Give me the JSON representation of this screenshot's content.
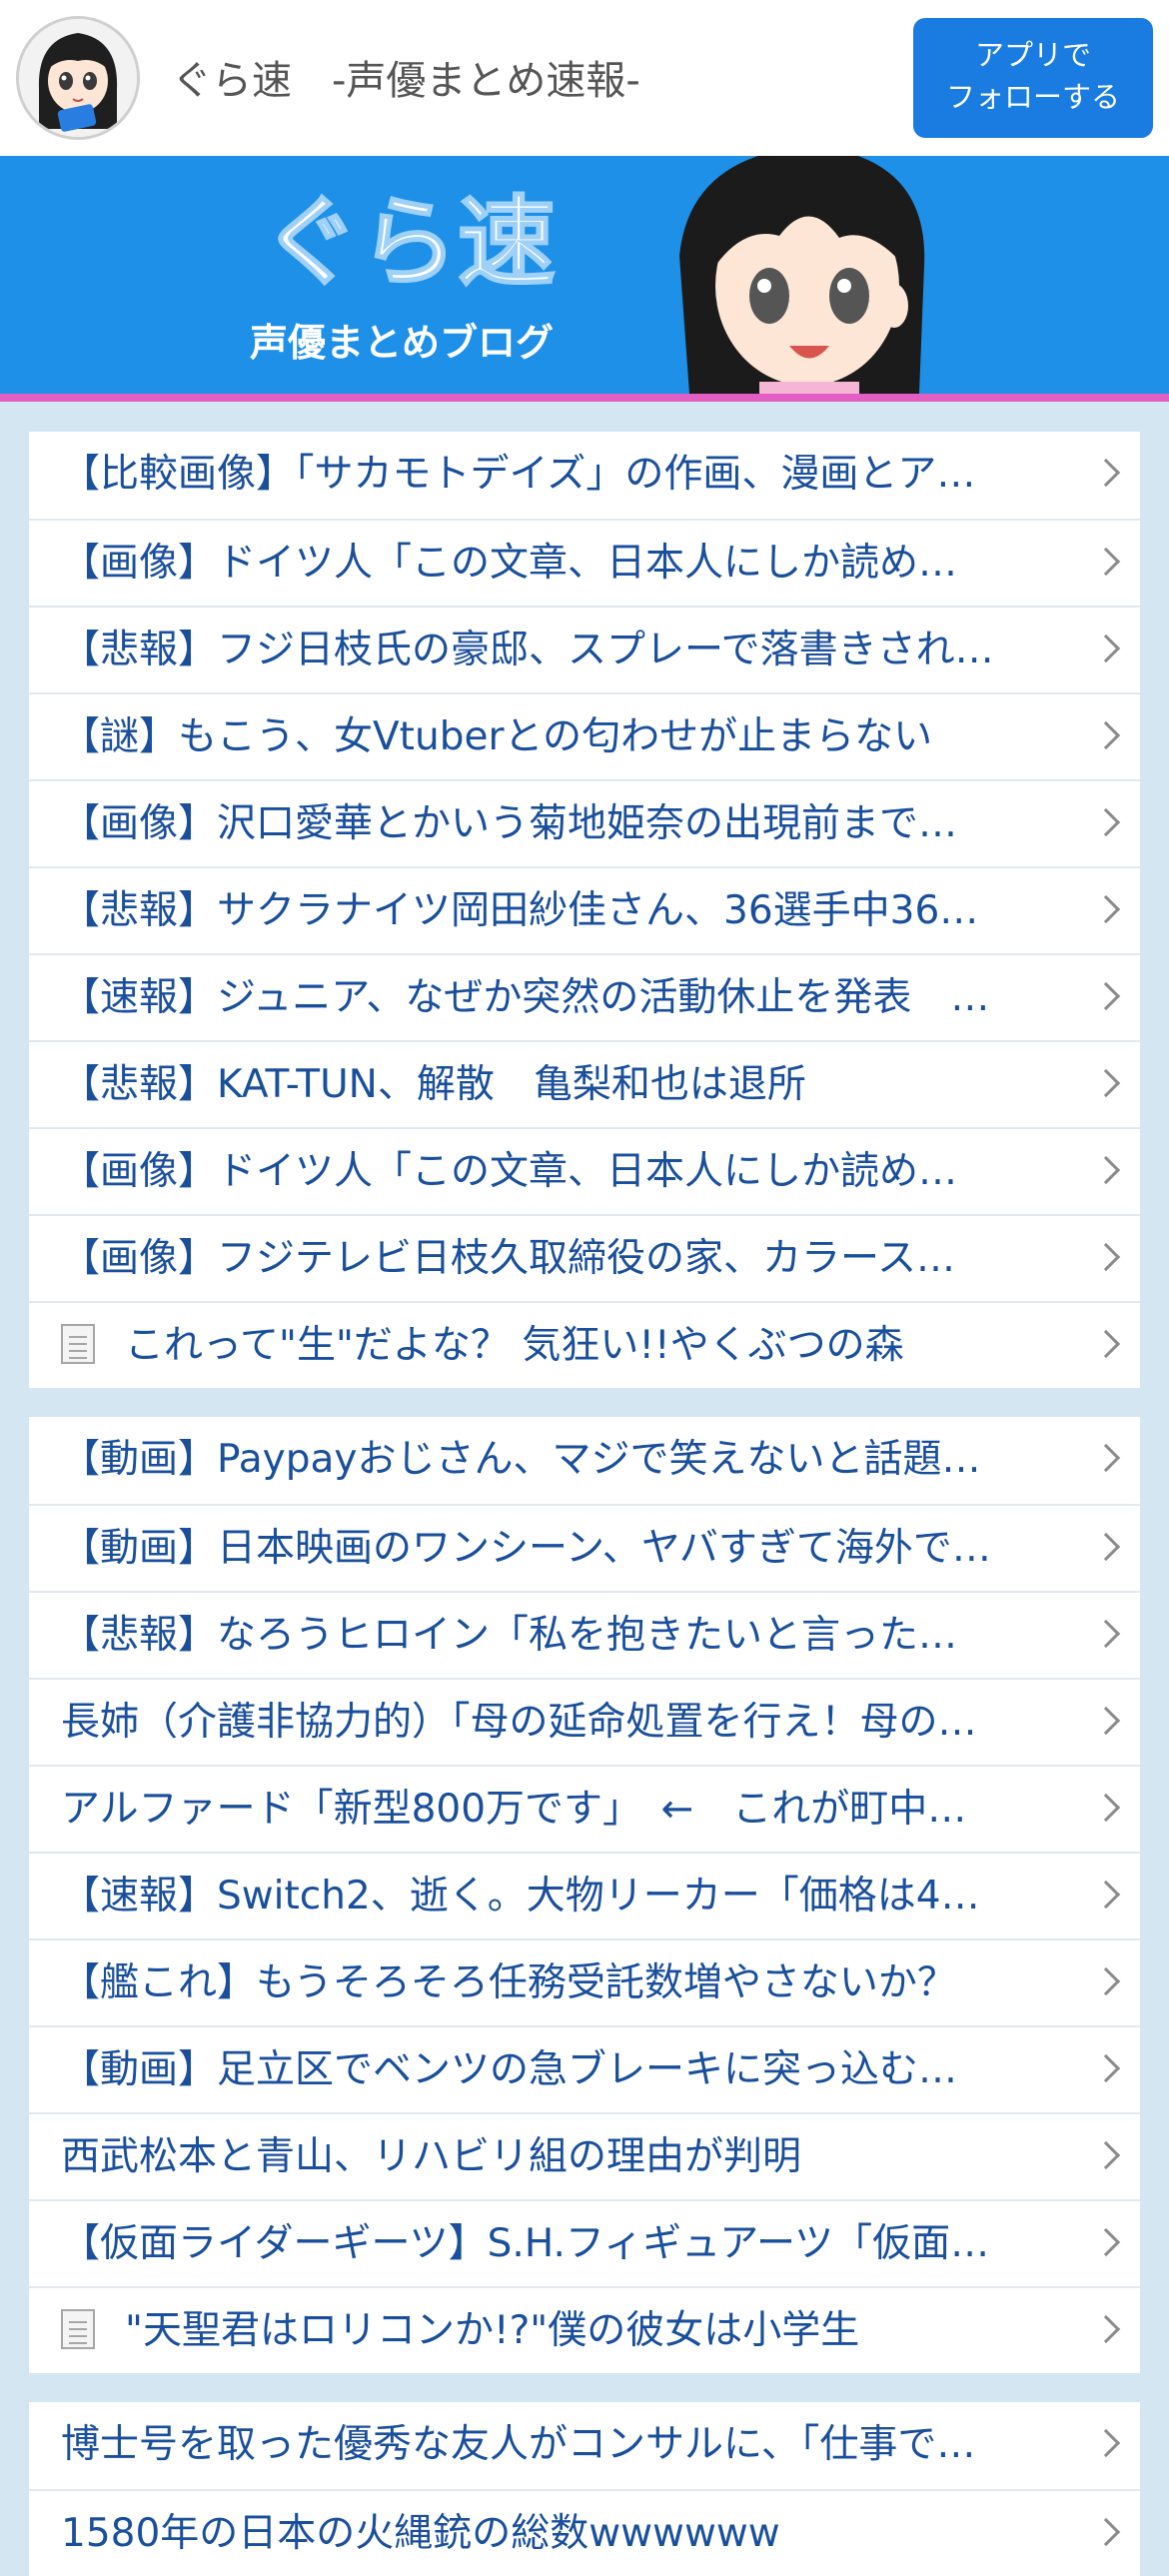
{
  "header": {
    "site_title": "ぐら速　-声優まとめ速報-",
    "follow_line1": "アプリで",
    "follow_line2": "フォローする"
  },
  "banner": {
    "logo_main": "ぐら速",
    "logo_sub": "声優まとめブログ"
  },
  "list1": [
    {
      "text": "【比較画像】「サカモトデイズ」の作画、漫画とア…"
    },
    {
      "text": "【画像】ドイツ人「この文章、日本人にしか読め…"
    },
    {
      "text": "【悲報】フジ日枝氏の豪邸、スプレーで落書きされ…"
    },
    {
      "text": "【謎】もこう、女Vtuberとの匂わせが止まらない"
    },
    {
      "text": "【画像】沢口愛華とかいう菊地姫奈の出現前まで…"
    },
    {
      "text": "【悲報】サクラナイツ岡田紗佳さん、36選手中36…"
    },
    {
      "text": "【速報】ジュニア、なぜか突然の活動休止を発表　…"
    },
    {
      "text": "【悲報】KAT-TUN、解散　亀梨和也は退所"
    },
    {
      "text": "【画像】ドイツ人「この文章、日本人にしか読め…"
    },
    {
      "text": "【画像】フジテレビ日枝久取締役の家、カラース…"
    },
    {
      "text": "これって\"生\"だよな？ 気狂い!!やくぶつの森",
      "icon": "document-icon"
    }
  ],
  "list2": [
    {
      "text": "【動画】Paypayおじさん、マジで笑えないと話題…"
    },
    {
      "text": "【動画】日本映画のワンシーン、ヤバすぎて海外で…"
    },
    {
      "text": "【悲報】なろうヒロイン「私を抱きたいと言った…"
    },
    {
      "text": "長姉（介護非協力的）「母の延命処置を行え！母の…"
    },
    {
      "text": "アルファード「新型800万です」　←　これが町中…"
    },
    {
      "text": "【速報】Switch2、逝く。大物リーカー「価格は4…"
    },
    {
      "text": "【艦これ】もうそろそろ任務受託数増やさないか？"
    },
    {
      "text": "【動画】足立区でベンツの急ブレーキに突っ込む…"
    },
    {
      "text": "西武松本と青山、リハビリ組の理由が判明"
    },
    {
      "text": "【仮面ライダーギーツ】S.H.フィギュアーツ「仮面…"
    },
    {
      "text": "\"天聖君はロリコンか!?\"僕の彼女は小学生",
      "icon": "document-icon"
    }
  ],
  "list3": [
    {
      "text": "博士号を取った優秀な友人がコンサルに、「仕事で…"
    },
    {
      "text": "1580年の日本の火縄銃の総数wwwwww"
    }
  ],
  "colors": {
    "link": "#1a4f9c",
    "follow_button": "#1a7ce0",
    "banner": "#1e90e8",
    "banner_underline": "#e25ec2",
    "page_background": "#d4e6f2"
  }
}
